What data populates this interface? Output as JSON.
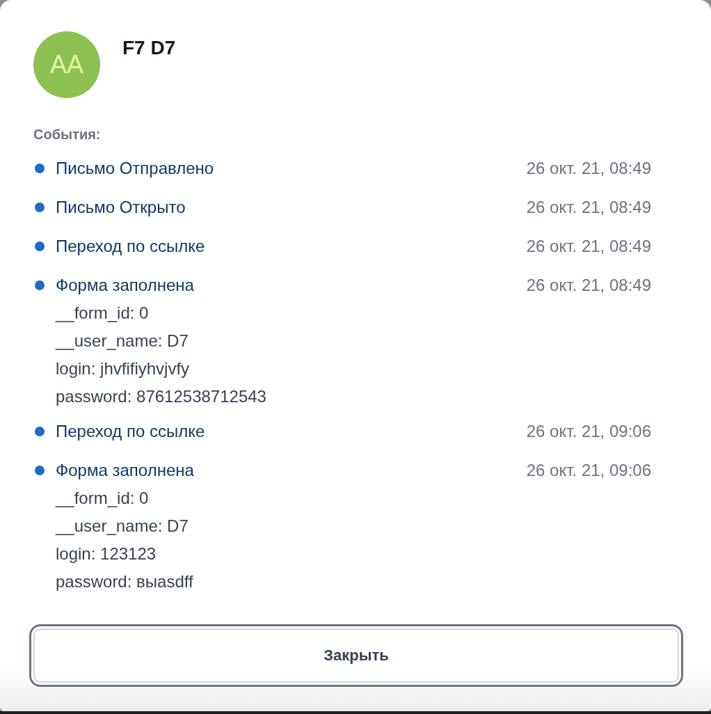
{
  "contact": {
    "avatar_initials": "AA",
    "name": "F7 D7"
  },
  "events_label": "События:",
  "events": [
    {
      "title": "Письмо Отправлено",
      "time": "26 окт. 21, 08:49"
    },
    {
      "title": "Письмо Открыто",
      "time": "26 окт. 21, 08:49"
    },
    {
      "title": "Переход по ссылке",
      "time": "26 окт. 21, 08:49"
    },
    {
      "title": "Форма заполнена",
      "time": "26 окт. 21, 08:49",
      "details": [
        "__form_id: 0",
        "__user_name: D7",
        "login: jhvfifiyhvjvfy",
        "password: 87612538712543"
      ]
    },
    {
      "title": "Переход по ссылке",
      "time": "26 окт. 21, 09:06"
    },
    {
      "title": "Форма заполнена",
      "time": "26 окт. 21, 09:06",
      "details": [
        "__form_id: 0",
        "__user_name: D7",
        "login: 123123",
        "password: выasdff"
      ]
    }
  ],
  "buttons": [
    {
      "label": "Закрыть",
      "focused": true
    }
  ]
}
